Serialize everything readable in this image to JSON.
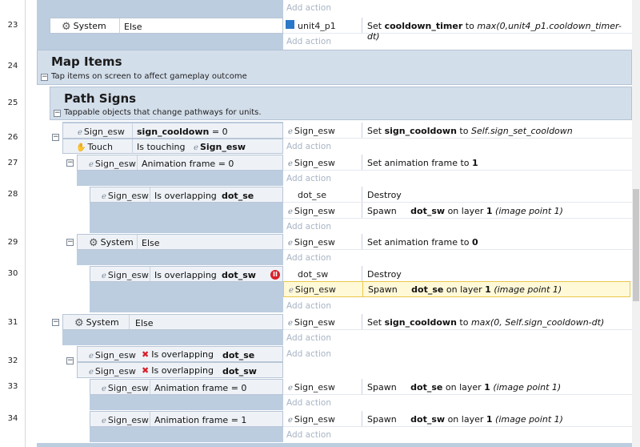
{
  "row_numbers": [
    "23",
    "24",
    "25",
    "26",
    "27",
    "28",
    "29",
    "30",
    "31",
    "32",
    "33",
    "34"
  ],
  "add_action": "Add action",
  "r23": {
    "system": "System",
    "cond": "Else",
    "act_obj": "unit4_p1",
    "act_set": "Set ",
    "act_var": "cooldown_timer",
    "act_to": " to ",
    "act_expr": "max(0,unit4_p1.cooldown_timer-dt)"
  },
  "map_items": {
    "title": "Map Items",
    "desc": "Tap items on screen to affect gameplay outcome"
  },
  "path_signs": {
    "title": "Path Signs",
    "desc": "Tappable objects that change pathways for units."
  },
  "r26": {
    "c1_obj": "Sign_esw",
    "c1_var": "sign_cooldown",
    "c1_rest": " = 0",
    "c2_obj": "Touch",
    "c2_txt": "Is touching",
    "c2_tgt": "Sign_esw",
    "a_obj": "Sign_esw",
    "a_set": "Set ",
    "a_var": "sign_cooldown",
    "a_to": " to ",
    "a_expr": "Self.sign_set_cooldown"
  },
  "r27": {
    "obj": "Sign_esw",
    "cond": "Animation frame = 0",
    "a_obj": "Sign_esw",
    "a_txt": "Set animation frame to ",
    "a_val": "1"
  },
  "r28": {
    "obj": "Sign_esw",
    "cond": "Is overlapping",
    "tgt": "dot_se",
    "a1_obj": "dot_se",
    "a1_txt": "Destroy",
    "a2_obj": "Sign_esw",
    "a2_txt": "Spawn",
    "a2_spawn": "dot_sw",
    "a2_on": " on layer ",
    "a2_layer": "1",
    "a2_ip": " (image point 1)"
  },
  "r29": {
    "system": "System",
    "cond": "Else",
    "a_obj": "Sign_esw",
    "a_txt": "Set animation frame to ",
    "a_val": "0"
  },
  "r30": {
    "obj": "Sign_esw",
    "cond": "Is overlapping",
    "tgt": "dot_sw",
    "breakpoint": "II",
    "a1_obj": "dot_sw",
    "a1_txt": "Destroy",
    "a2_obj": "Sign_esw",
    "a2_txt": "Spawn",
    "a2_spawn": "dot_se",
    "a2_on": " on layer ",
    "a2_layer": "1",
    "a2_ip": " (image point 1)"
  },
  "r31": {
    "system": "System",
    "cond": "Else",
    "a_obj": "Sign_esw",
    "a_set": "Set ",
    "a_var": "sign_cooldown",
    "a_to": " to ",
    "a_expr": "max(0, Self.sign_cooldown-dt)"
  },
  "r32": {
    "c1_obj": "Sign_esw",
    "c1_txt": "Is overlapping",
    "c1_tgt": "dot_se",
    "c2_obj": "Sign_esw",
    "c2_txt": "Is overlapping",
    "c2_tgt": "dot_sw"
  },
  "r33": {
    "obj": "Sign_esw",
    "cond": "Animation frame = 0",
    "a_obj": "Sign_esw",
    "a_txt": "Spawn",
    "a_spawn": "dot_se",
    "a_on": " on layer ",
    "a_layer": "1",
    "a_ip": " (image point 1)"
  },
  "r34": {
    "obj": "Sign_esw",
    "cond": "Animation frame = 1",
    "a_obj": "Sign_esw",
    "a_txt": "Spawn",
    "a_spawn": "dot_sw",
    "a_on": " on layer ",
    "a_layer": "1",
    "a_ip": " (image point 1)"
  }
}
